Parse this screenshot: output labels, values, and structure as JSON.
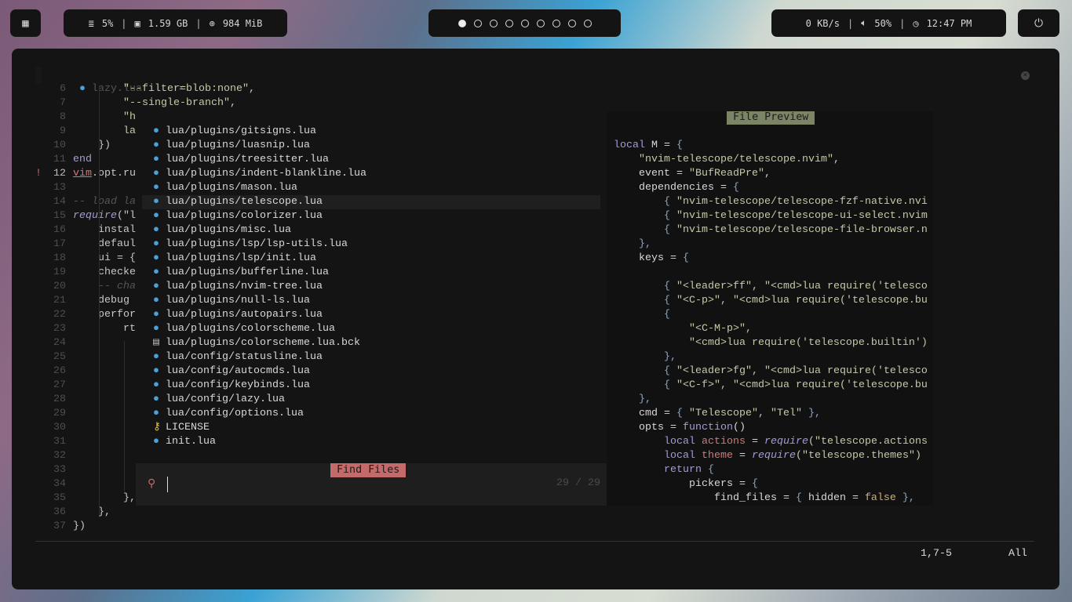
{
  "topbar": {
    "stats": {
      "cpu": "5%",
      "ram": "1.59 GB",
      "mem": "984 MiB"
    },
    "workspaces": {
      "count": 9,
      "active": 1
    },
    "right": {
      "net": "0 KB/s",
      "volume": "50%",
      "clock": "12:47 PM"
    }
  },
  "editor": {
    "tab": {
      "label": "lazy.lua",
      "close": "×"
    },
    "lines": [
      {
        "n": "6",
        "t": [
          [
            "        ",
            ""
          ],
          [
            "\"--filter=blob:none\"",
            "str"
          ],
          [
            ",",
            ""
          ]
        ]
      },
      {
        "n": "7",
        "t": [
          [
            "        ",
            ""
          ],
          [
            "\"--single-branch\"",
            "str"
          ],
          [
            ",",
            ""
          ]
        ]
      },
      {
        "n": "8",
        "t": [
          [
            "        ",
            ""
          ],
          [
            "\"h",
            "str"
          ]
        ]
      },
      {
        "n": "9",
        "t": [
          [
            "        ",
            ""
          ],
          [
            "la",
            "str"
          ]
        ]
      },
      {
        "n": "10",
        "t": [
          [
            "    })",
            ""
          ]
        ]
      },
      {
        "n": "11",
        "t": [
          [
            "end",
            "kw"
          ]
        ]
      },
      {
        "n": "12",
        "t": [
          [
            "vim",
            "red u"
          ],
          [
            ".opt.ru",
            ""
          ]
        ],
        "cur": true,
        "sign": "!"
      },
      {
        "n": "13",
        "t": []
      },
      {
        "n": "14",
        "t": [
          [
            "-- load la",
            "cm"
          ]
        ]
      },
      {
        "n": "15",
        "t": [
          [
            "require",
            "kw it"
          ],
          [
            "(\"l",
            ""
          ]
        ]
      },
      {
        "n": "16",
        "t": [
          [
            "    instal",
            ""
          ]
        ]
      },
      {
        "n": "17",
        "t": [
          [
            "    defaul",
            ""
          ]
        ]
      },
      {
        "n": "18",
        "t": [
          [
            "    ui = {",
            ""
          ]
        ]
      },
      {
        "n": "19",
        "t": [
          [
            "    checke",
            ""
          ]
        ]
      },
      {
        "n": "20",
        "t": [
          [
            "    -- cha",
            "cm"
          ]
        ]
      },
      {
        "n": "21",
        "t": [
          [
            "    debug ",
            ""
          ]
        ]
      },
      {
        "n": "22",
        "t": [
          [
            "    perfor",
            ""
          ]
        ]
      },
      {
        "n": "23",
        "t": [
          [
            "        rt",
            ""
          ]
        ]
      },
      {
        "n": "24",
        "t": []
      },
      {
        "n": "25",
        "t": []
      },
      {
        "n": "26",
        "t": []
      },
      {
        "n": "27",
        "t": []
      },
      {
        "n": "28",
        "t": []
      },
      {
        "n": "29",
        "t": []
      },
      {
        "n": "30",
        "t": []
      },
      {
        "n": "31",
        "t": []
      },
      {
        "n": "32",
        "t": []
      },
      {
        "n": "33",
        "t": []
      },
      {
        "n": "34",
        "t": []
      },
      {
        "n": "35",
        "t": [
          [
            "        },",
            ""
          ]
        ]
      },
      {
        "n": "36",
        "t": [
          [
            "    },",
            ""
          ]
        ]
      },
      {
        "n": "37",
        "t": [
          [
            "})",
            ""
          ]
        ]
      }
    ],
    "status": {
      "position": "1,7-5",
      "scroll": "All"
    }
  },
  "telescope": {
    "results": [
      {
        "path": "lua/plugins/gitsigns.lua",
        "icon": "lua"
      },
      {
        "path": "lua/plugins/luasnip.lua",
        "icon": "lua"
      },
      {
        "path": "lua/plugins/treesitter.lua",
        "icon": "lua"
      },
      {
        "path": "lua/plugins/indent-blankline.lua",
        "icon": "lua"
      },
      {
        "path": "lua/plugins/mason.lua",
        "icon": "lua"
      },
      {
        "path": "lua/plugins/telescope.lua",
        "icon": "lua",
        "selected": true
      },
      {
        "path": "lua/plugins/colorizer.lua",
        "icon": "lua"
      },
      {
        "path": "lua/plugins/misc.lua",
        "icon": "lua"
      },
      {
        "path": "lua/plugins/lsp/lsp-utils.lua",
        "icon": "lua"
      },
      {
        "path": "lua/plugins/lsp/init.lua",
        "icon": "lua"
      },
      {
        "path": "lua/plugins/bufferline.lua",
        "icon": "lua"
      },
      {
        "path": "lua/plugins/nvim-tree.lua",
        "icon": "lua"
      },
      {
        "path": "lua/plugins/null-ls.lua",
        "icon": "lua"
      },
      {
        "path": "lua/plugins/autopairs.lua",
        "icon": "lua"
      },
      {
        "path": "lua/plugins/colorscheme.lua",
        "icon": "lua"
      },
      {
        "path": "lua/plugins/colorscheme.lua.bck",
        "icon": "file"
      },
      {
        "path": "lua/config/statusline.lua",
        "icon": "lua"
      },
      {
        "path": "lua/config/autocmds.lua",
        "icon": "lua"
      },
      {
        "path": "lua/config/keybinds.lua",
        "icon": "lua"
      },
      {
        "path": "lua/config/lazy.lua",
        "icon": "lua"
      },
      {
        "path": "lua/config/options.lua",
        "icon": "lua"
      },
      {
        "path": "LICENSE",
        "icon": "key"
      },
      {
        "path": "init.lua",
        "icon": "lua"
      }
    ],
    "prompt": {
      "title": "Find Files",
      "value": "",
      "count": "29 / 29"
    },
    "preview": {
      "title": "File Preview",
      "lines": [
        [
          [
            "local",
            "kw"
          ],
          [
            " M = ",
            "id"
          ],
          [
            "{",
            "br"
          ]
        ],
        [
          [
            "    \"nvim-telescope/telescope.nvim\"",
            "str"
          ],
          [
            ",",
            ""
          ]
        ],
        [
          [
            "    event = ",
            "id"
          ],
          [
            "\"BufReadPre\"",
            "str"
          ],
          [
            ",",
            ""
          ]
        ],
        [
          [
            "    dependencies = ",
            "id"
          ],
          [
            "{",
            "br"
          ]
        ],
        [
          [
            "        ",
            ""
          ],
          [
            "{",
            "br"
          ],
          [
            " \"nvim-telescope/telescope-fzf-native.nvi",
            "str"
          ]
        ],
        [
          [
            "        ",
            ""
          ],
          [
            "{",
            "br"
          ],
          [
            " \"nvim-telescope/telescope-ui-select.nvim",
            "str"
          ]
        ],
        [
          [
            "        ",
            ""
          ],
          [
            "{",
            "br"
          ],
          [
            " \"nvim-telescope/telescope-file-browser.n",
            "str"
          ]
        ],
        [
          [
            "    },",
            "br"
          ]
        ],
        [
          [
            "    keys = ",
            "id"
          ],
          [
            "{",
            "br"
          ]
        ],
        [],
        [
          [
            "        ",
            ""
          ],
          [
            "{",
            "br"
          ],
          [
            " \"<leader>ff\", \"<cmd>lua require('telesco",
            "str"
          ]
        ],
        [
          [
            "        ",
            ""
          ],
          [
            "{",
            "br"
          ],
          [
            " \"<C-p>\", \"<cmd>lua require('telescope.bu",
            "str"
          ]
        ],
        [
          [
            "        {",
            "br"
          ]
        ],
        [
          [
            "            \"<C-M-p>\",",
            "str"
          ]
        ],
        [
          [
            "            \"<cmd>lua require('telescope.builtin')",
            "str"
          ]
        ],
        [
          [
            "        },",
            "br"
          ]
        ],
        [
          [
            "        ",
            ""
          ],
          [
            "{",
            "br"
          ],
          [
            " \"<leader>fg\", \"<cmd>lua require('telesco",
            "str"
          ]
        ],
        [
          [
            "        ",
            ""
          ],
          [
            "{",
            "br"
          ],
          [
            " \"<C-f>\", \"<cmd>lua require('telescope.bu",
            "str"
          ]
        ],
        [
          [
            "    },",
            "br"
          ]
        ],
        [
          [
            "    cmd = ",
            "id"
          ],
          [
            "{",
            "br"
          ],
          [
            " \"Telescope\", \"Tel\" ",
            "str"
          ],
          [
            "},",
            "br"
          ]
        ],
        [
          [
            "    opts = ",
            "id"
          ],
          [
            "function",
            "kw"
          ],
          [
            "()",
            "id"
          ]
        ],
        [
          [
            "        ",
            ""
          ],
          [
            "local",
            "kw"
          ],
          [
            " actions",
            "red"
          ],
          [
            " = ",
            "id"
          ],
          [
            "require",
            "kw it"
          ],
          [
            "(\"telescope.actions",
            "str"
          ]
        ],
        [
          [
            "        ",
            ""
          ],
          [
            "local",
            "kw"
          ],
          [
            " theme",
            "red"
          ],
          [
            " = ",
            "id"
          ],
          [
            "require",
            "kw it"
          ],
          [
            "(\"telescope.themes\")",
            "str"
          ]
        ],
        [
          [
            "        ",
            ""
          ],
          [
            "return",
            "kw"
          ],
          [
            " {",
            "br"
          ]
        ],
        [
          [
            "            pickers = ",
            "id"
          ],
          [
            "{",
            "br"
          ]
        ],
        [
          [
            "                find_files = ",
            "id"
          ],
          [
            "{",
            "br"
          ],
          [
            " hidden = ",
            "id"
          ],
          [
            "false",
            "bool"
          ],
          [
            " },",
            "br"
          ]
        ]
      ]
    }
  },
  "colors": {
    "accent_find": "#c46a6a",
    "accent_preview": "#7c8466",
    "lua_icon": "#4d9fd6"
  }
}
